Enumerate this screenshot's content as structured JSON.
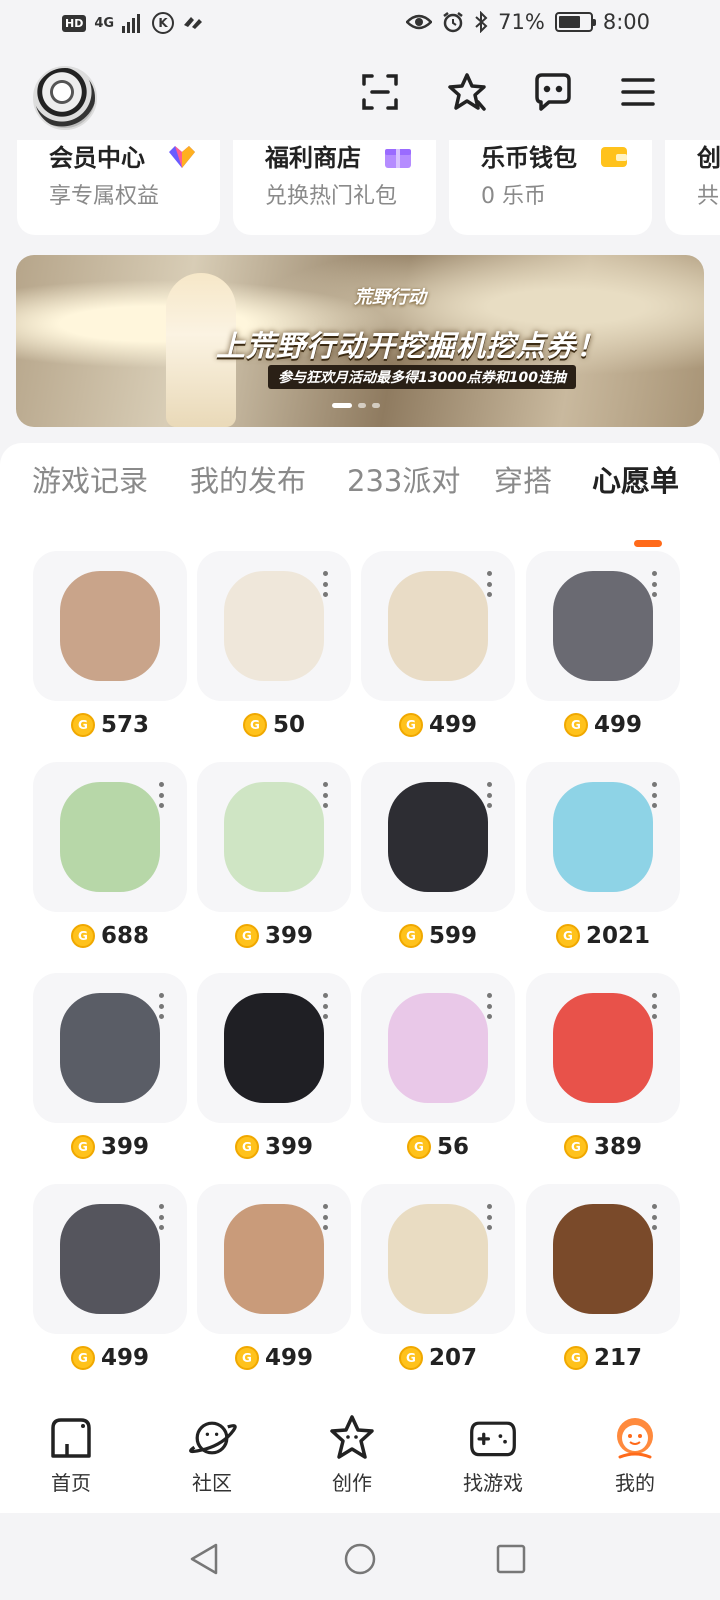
{
  "status_bar": {
    "hd": "HD",
    "network": "4G",
    "k_icon": "K",
    "battery_percent": "71%",
    "battery_level": 0.71,
    "time": "8:00"
  },
  "header": {
    "icons": [
      "scan-icon",
      "star-icon",
      "message-icon",
      "menu-icon"
    ]
  },
  "quick_cards": [
    {
      "title": "会员中心",
      "sub": "享专属权益",
      "icon_color": "#6a5cff"
    },
    {
      "title": "福利商店",
      "sub": "兑换热门礼包",
      "icon_color": "#b58cff"
    },
    {
      "title": "乐币钱包",
      "sub": "0 乐币",
      "icon_color": "#ffc21c"
    },
    {
      "title": "创",
      "sub": "共",
      "icon_color": "#ff8a3d"
    }
  ],
  "banner": {
    "logo": "荒野行动",
    "title": "上荒野行动开挖掘机挖点券！",
    "subtitle": "参与狂欢月活动最多得13000点券和100连抽"
  },
  "tabs": [
    {
      "label": "游戏记录",
      "active": false
    },
    {
      "label": "我的发布",
      "active": false
    },
    {
      "label": "233派对",
      "active": false
    },
    {
      "label": "穿搭",
      "active": false
    },
    {
      "label": "心愿单",
      "active": true
    }
  ],
  "wishlist": [
    {
      "price": "573",
      "thumb": "#c9a48a",
      "more": false
    },
    {
      "price": "50",
      "thumb": "#efe7da",
      "more": true
    },
    {
      "price": "499",
      "thumb": "#e9dcc6",
      "more": true
    },
    {
      "price": "499",
      "thumb": "#6a6a72",
      "more": true
    },
    {
      "price": "688",
      "thumb": "#b7d7a8",
      "more": true
    },
    {
      "price": "399",
      "thumb": "#cfe5c4",
      "more": true
    },
    {
      "price": "599",
      "thumb": "#2d2d33",
      "more": true
    },
    {
      "price": "2021",
      "thumb": "#8ed3e6",
      "more": true
    },
    {
      "price": "399",
      "thumb": "#5a5d66",
      "more": true
    },
    {
      "price": "399",
      "thumb": "#1f1f24",
      "more": true
    },
    {
      "price": "56",
      "thumb": "#e9c8e8",
      "more": true
    },
    {
      "price": "389",
      "thumb": "#e8524a",
      "more": true
    },
    {
      "price": "499",
      "thumb": "#55555d",
      "more": true
    },
    {
      "price": "499",
      "thumb": "#c99b7a",
      "more": true
    },
    {
      "price": "207",
      "thumb": "#e9dcc2",
      "more": true
    },
    {
      "price": "217",
      "thumb": "#7a4a2a",
      "more": true
    }
  ],
  "coin_symbol": "G",
  "bottom_nav": [
    {
      "label": "首页",
      "icon": "home-icon",
      "active": false
    },
    {
      "label": "社区",
      "icon": "planet-icon",
      "active": false
    },
    {
      "label": "创作",
      "icon": "star-face-icon",
      "active": false
    },
    {
      "label": "找游戏",
      "icon": "gamepad-icon",
      "active": false
    },
    {
      "label": "我的",
      "icon": "profile-icon",
      "active": true
    }
  ],
  "colors": {
    "accent": "#ff6a1a",
    "coin": "#ffc21c"
  }
}
